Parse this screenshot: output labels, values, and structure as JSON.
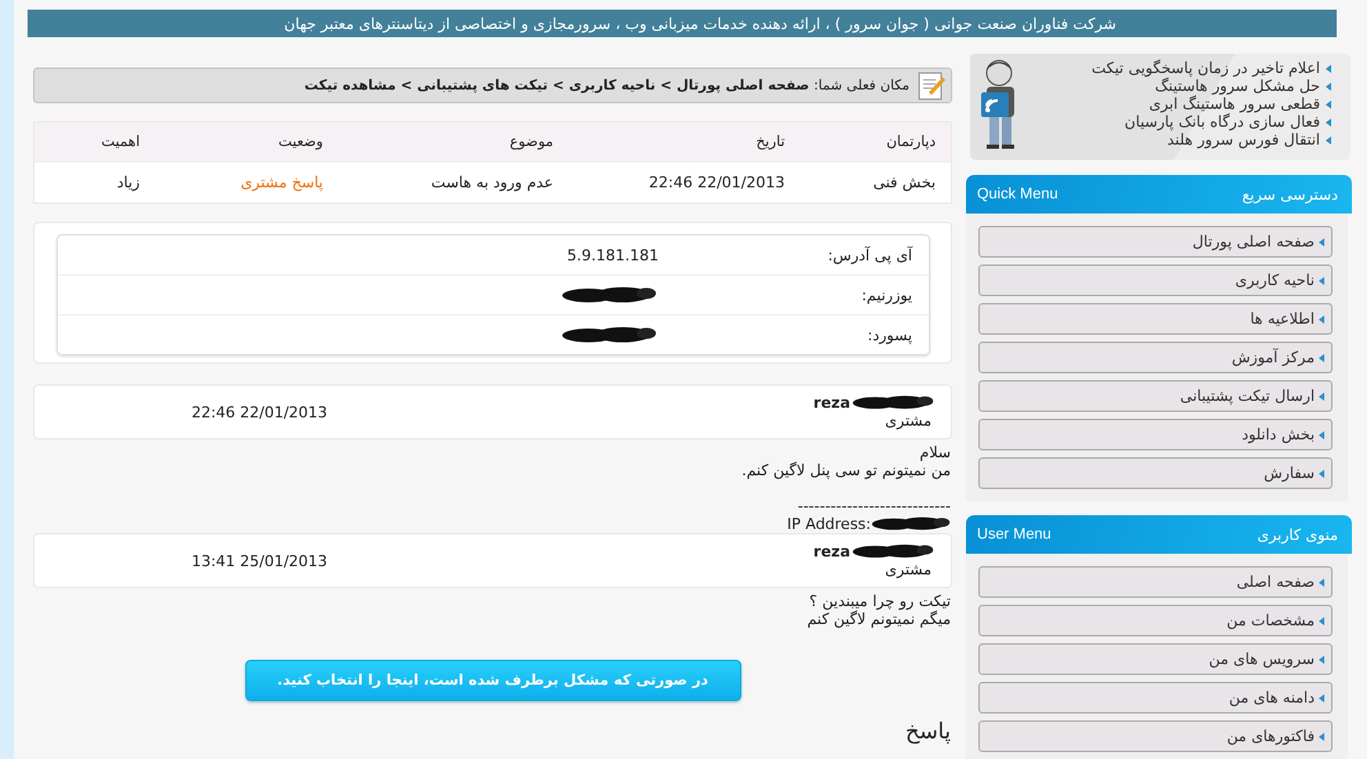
{
  "header": {
    "text": "شرکت فناوران صنعت جوانی ( جوان سرور ) ، ارائه دهنده خدمات میزبانی وب ، سرورمجازی و اختصاصی از دیتاسنترهای معتبر جهان"
  },
  "breadcrumb": {
    "text": "مکان فعلی شما: **صفحه اصلی پورتال > ناحیه کاربری > تیکت های پشتیبانی > مشاهده تیکت**"
  },
  "ticket_table": {
    "columns": [
      "دپارتمان",
      "تاریخ",
      "موضوع",
      "وضعیت",
      "اهمیت"
    ],
    "row": [
      "بخش فنی",
      "22:46 22/01/2013",
      "عدم ورود به هاست",
      "پاسخ مشتری",
      "زیاد"
    ]
  },
  "account_info": [
    {
      "label": "آی پی آدرس:",
      "value": "5.9.181.181",
      "redacted": false
    },
    {
      "label": "یوزرنیم:",
      "redacted": true
    },
    {
      "label": "پسورد:",
      "redacted": true
    }
  ],
  "messages": [
    {
      "author": "reza",
      "author_redacted": true,
      "role": "مشتری",
      "date": "22:46 22/01/2013",
      "lines": [
        "سلام",
        "من نمیتونم تو سی پنل لاگین کنم."
      ],
      "signature": {
        "separator": "----------------------------",
        "ip_label": "IP Address:",
        "ip_redacted": true
      }
    },
    {
      "author": "reza",
      "author_redacted": true,
      "role": "مشتری",
      "date": "13:41 25/01/2013",
      "lines": [
        "تیکت رو چرا میبندین ؟",
        "میگم نمیتونم لاگین کنم"
      ]
    }
  ],
  "resolve_button": {
    "label": "در صورتی که مشکل برطرف شده است، اینجا را انتخاب کنید."
  },
  "reply_heading": {
    "text": "پاسخ"
  },
  "sidebar": {
    "announcements": [
      "اعلام تاخیر در زمان پاسخگویی تیکت",
      "حل مشکل سرور هاستینگ",
      "قطعی سرور هاستینگ ابری",
      "فعال سازی درگاه بانک پارسیان",
      "انتقال فورس سرور هلند"
    ],
    "menus": [
      {
        "title": "دسترسی سریع",
        "title_en": "Quick Menu",
        "items": [
          "صفحه اصلی پورتال",
          "ناحیه کاربری",
          "اطلاعیه ها",
          "مرکز آموزش",
          "ارسال تیکت پشتیبانی",
          "بخش دانلود",
          "سفارش"
        ]
      },
      {
        "title": "منوی کاربری",
        "title_en": "User Menu",
        "items": [
          "صفحه اصلی",
          "مشخصات من",
          "سرویس های من",
          "دامنه های من",
          "فاکتورهای من"
        ]
      }
    ]
  }
}
